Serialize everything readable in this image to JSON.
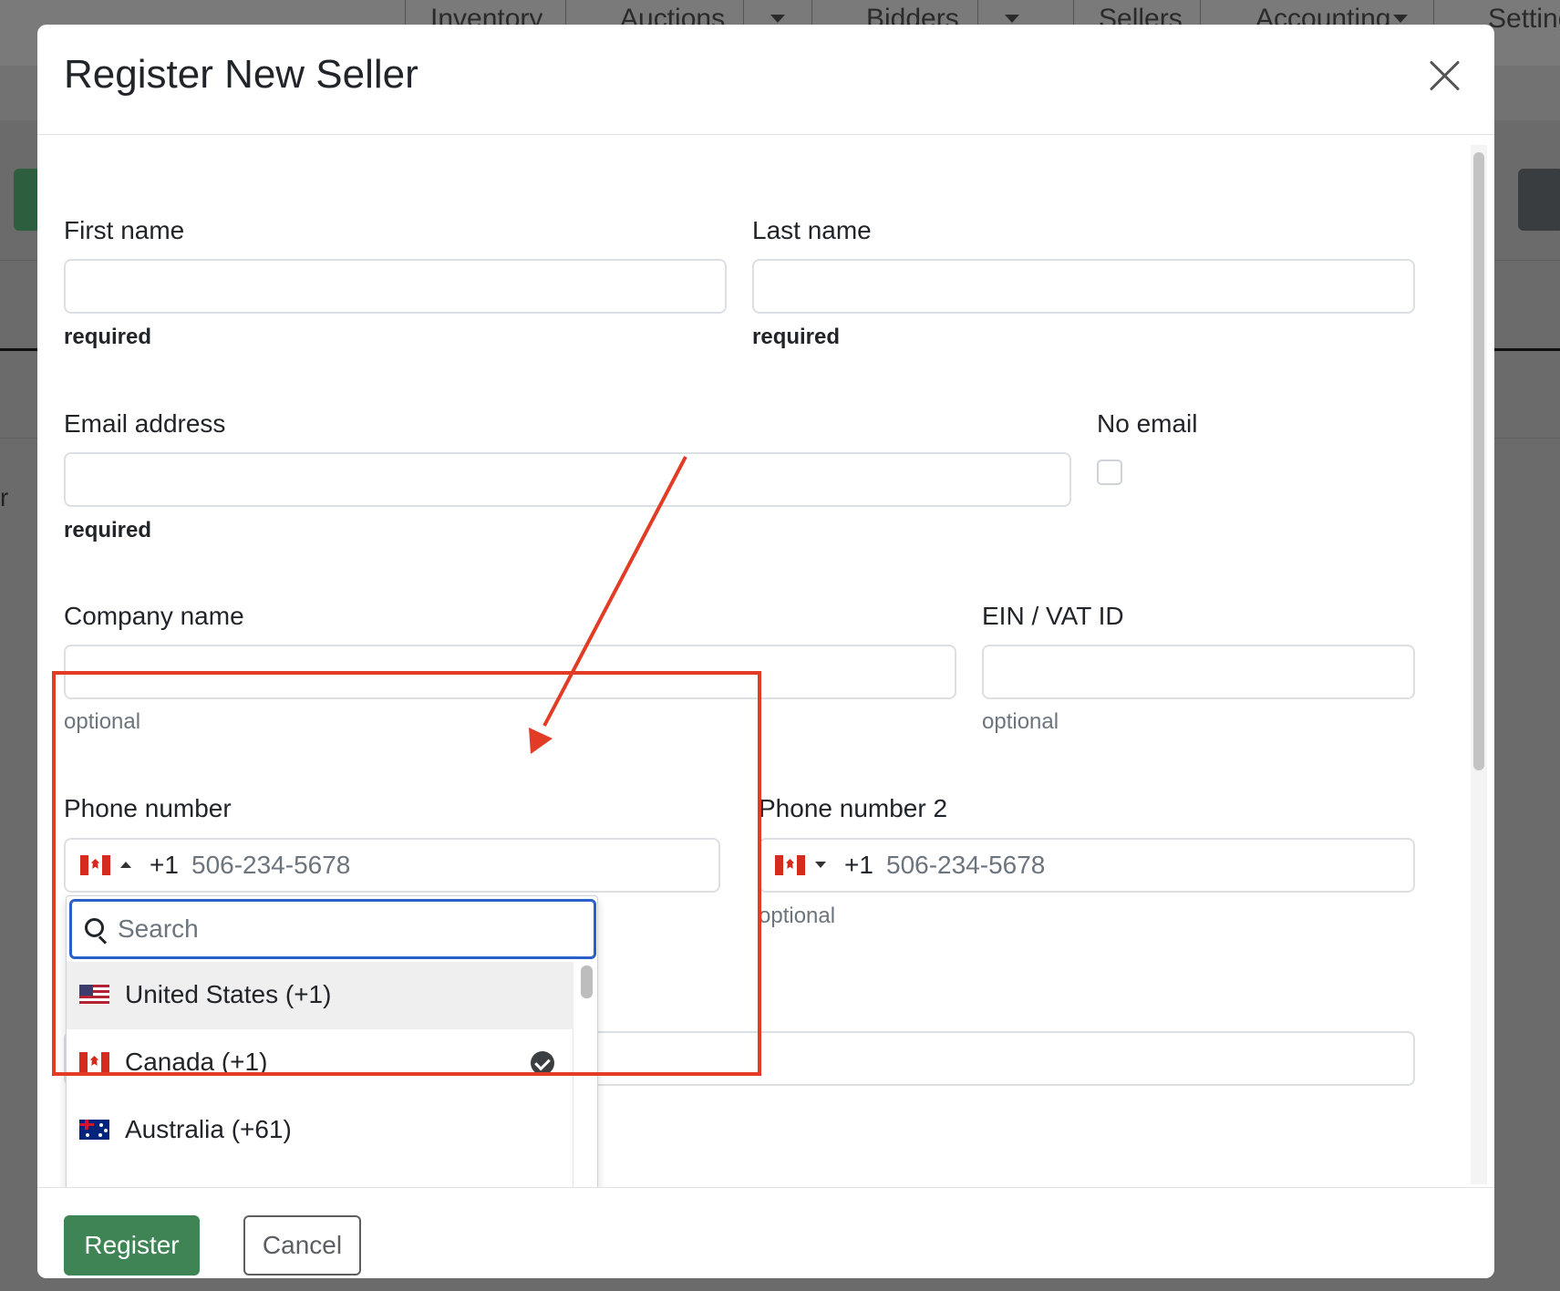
{
  "background_nav": {
    "items": [
      {
        "label": "Inventory"
      },
      {
        "label": "Auctions"
      },
      {
        "label": "Bidders"
      },
      {
        "label": "Sellers"
      },
      {
        "label": "Accounting"
      },
      {
        "label": "Settings"
      }
    ],
    "partial_text": "r"
  },
  "modal": {
    "title": "Register New Seller",
    "fields": {
      "first_name": {
        "label": "First name",
        "value": "",
        "hint": "required"
      },
      "last_name": {
        "label": "Last name",
        "value": "",
        "hint": "required"
      },
      "email": {
        "label": "Email address",
        "value": "",
        "hint": "required"
      },
      "no_email": {
        "label": "No email",
        "checked": false
      },
      "company": {
        "label": "Company name",
        "value": "",
        "hint": "optional"
      },
      "ein": {
        "label": "EIN / VAT ID",
        "value": "",
        "hint": "optional"
      },
      "phone": {
        "label": "Phone number",
        "dial_code": "+1",
        "placeholder": "506-234-5678",
        "country": "Canada"
      },
      "phone2": {
        "label": "Phone number 2",
        "dial_code": "+1",
        "placeholder": "506-234-5678",
        "country": "Canada",
        "hint": "optional"
      }
    },
    "country_dropdown": {
      "search_placeholder": "Search",
      "countries": [
        {
          "name": "United States (+1)",
          "flag": "us-flag-icon",
          "highlighted": true,
          "selected": false
        },
        {
          "name": "Canada (+1)",
          "flag": "ca-flag-icon",
          "highlighted": false,
          "selected": true
        },
        {
          "name": "Australia (+61)",
          "flag": "au-flag-icon",
          "highlighted": false,
          "selected": false
        }
      ]
    },
    "footer": {
      "register_label": "Register",
      "cancel_label": "Cancel"
    }
  },
  "colors": {
    "primary_green": "#3f8455",
    "focus_blue": "#2a5fc9",
    "annotation_red": "#e23c26",
    "overlay": "#6b6b6b"
  }
}
